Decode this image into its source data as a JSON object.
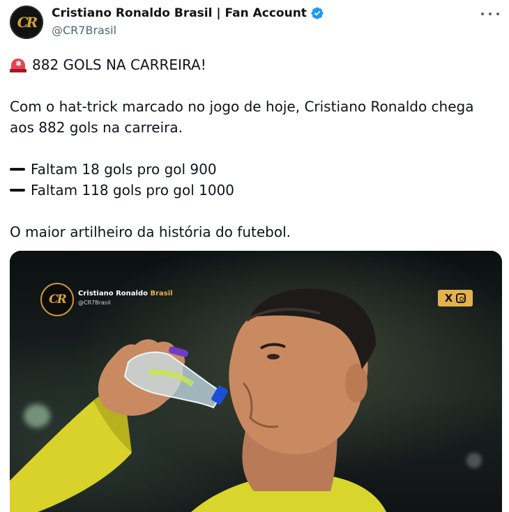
{
  "header": {
    "display_name": "Cristiano Ronaldo Brasil | Fan Account",
    "handle": "@CR7Brasil",
    "avatar_monogram": "CR"
  },
  "tweet": {
    "line1": "882 GOLS NA CARREIRA!",
    "para1": "Com o hat-trick marcado no jogo de hoje, Cristiano Ronaldo chega aos 882 gols na carreira.",
    "bullet1": "Faltam 18 gols pro gol 900",
    "bullet2": "Faltam 118 gols pro gol 1000",
    "para2": "O maior artilheiro da história do futebol."
  },
  "media": {
    "brand_name": "Cristiano Ronaldo",
    "brand_name_accent": "Brasil",
    "brand_handle": "@CR7Brasil",
    "logo_monogram": "CR",
    "social_x": "X",
    "accent_color": "#e3b24a"
  },
  "icons": [
    "verified-badge-icon",
    "more-options-icon",
    "police-siren-icon",
    "heavy-minus-icon",
    "x-logo-icon",
    "instagram-icon"
  ]
}
